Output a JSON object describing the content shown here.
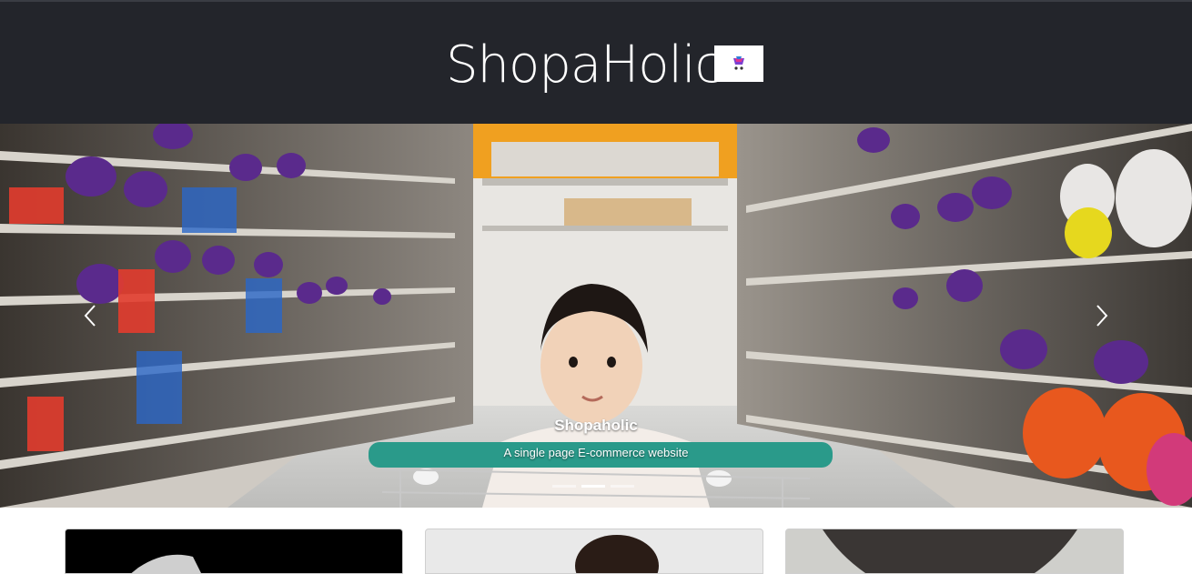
{
  "header": {
    "brand": "ShopaHolic",
    "logo_icon": "shopping-cart-logo-icon",
    "background": "#23252b"
  },
  "carousel": {
    "slide": {
      "caption_title": "Shopaholic",
      "caption_text": "A single page E-commerce website",
      "image": "photo of toddler in a shopping cart in a store aisle"
    },
    "prev_icon": "chevron-left-icon",
    "next_icon": "chevron-right-icon",
    "indicators": [
      {
        "active": false
      },
      {
        "active": true
      },
      {
        "active": false
      }
    ]
  },
  "cards": [
    {
      "image": "product-photo-dark"
    },
    {
      "image": "product-photo-person"
    },
    {
      "image": "product-photo-garment"
    }
  ]
}
